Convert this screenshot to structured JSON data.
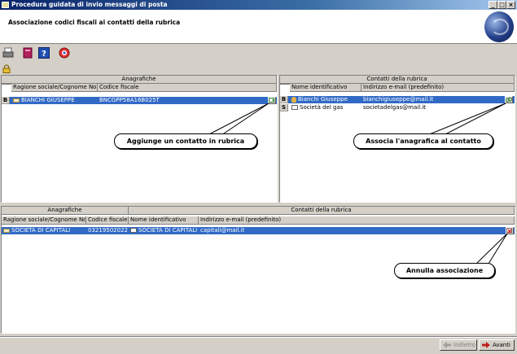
{
  "window": {
    "title": "Procedura guidata di invio messaggi di posta",
    "controls": [
      "_",
      "□",
      "×"
    ]
  },
  "header": {
    "title": "Associazione codici fiscali ai contatti della rubrica"
  },
  "toolbar": {
    "icons": [
      "print-icon",
      "book-icon",
      "help-icon",
      "exit-icon",
      "lock-icon"
    ]
  },
  "top_left": {
    "group_title": "Anagrafiche",
    "columns": [
      "Ragione sociale/Cognome Nome",
      "Codice fiscale"
    ],
    "rows": [
      {
        "marker": "B",
        "name": "BIANCHI GIUSEPPE",
        "cf": "BNCGPP58A16B025T",
        "selected": true
      }
    ]
  },
  "top_right": {
    "group_title": "Contatti della rubrica",
    "columns": [
      "Nome identificativo",
      "Indirizzo e-mail (predefinito)"
    ],
    "rows": [
      {
        "marker": "B",
        "name": "Bianchi Giuseppe",
        "email": "bianchigiuseppe@mail.it",
        "selected": true
      },
      {
        "marker": "S",
        "name": "Società del gas",
        "email": "societadelgas@mail.it",
        "selected": false
      }
    ]
  },
  "bottom": {
    "group_left": "Anagrafiche",
    "group_right": "Contatti della rubrica",
    "columns": [
      "Ragione sociale/Cognome Nome",
      "Codice fiscale",
      "Nome identificativo",
      "Indirizzo e-mail (predefinito)"
    ],
    "rows": [
      {
        "name": "SOCIETÀ DI CAPITALI",
        "cf": "03219502022",
        "contact": "SOCIETÀ DI CAPITALI",
        "email": "capitali@mail.it",
        "selected": true
      }
    ]
  },
  "callouts": {
    "add": "Aggiunge un contatto in rubrica",
    "associate": "Associa l'anagrafica al contatto",
    "cancel": "Annulla associazione"
  },
  "footer": {
    "back_label": "Indietro",
    "next_label": "Avanti"
  }
}
